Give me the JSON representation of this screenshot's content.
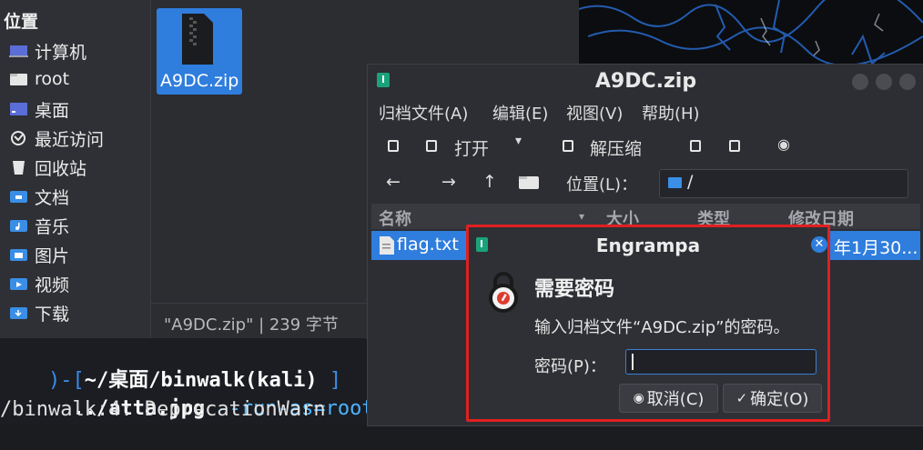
{
  "file_manager": {
    "sidebar": {
      "heading": "位置",
      "items": [
        {
          "label": "计算机",
          "icon": "computer-icon"
        },
        {
          "label": "root",
          "icon": "home-folder-icon"
        },
        {
          "label": "桌面",
          "icon": "desktop-icon"
        },
        {
          "label": "最近访问",
          "icon": "recent-icon"
        },
        {
          "label": "回收站",
          "icon": "trash-icon"
        },
        {
          "label": "文档",
          "icon": "documents-folder-icon"
        },
        {
          "label": "音乐",
          "icon": "music-folder-icon"
        },
        {
          "label": "图片",
          "icon": "pictures-folder-icon"
        },
        {
          "label": "视频",
          "icon": "videos-folder-icon"
        },
        {
          "label": "下载",
          "icon": "downloads-folder-icon"
        }
      ]
    },
    "file": {
      "name": "A9DC.zip",
      "icon": "zip-archive-icon"
    },
    "status": "\"A9DC.zip\" | 239 字节"
  },
  "terminal": {
    "prompt_open": ")-[",
    "prompt_path": "~/桌面/binwalk(kali)",
    "prompt_close": "]",
    "cmd_arg": "../atta.jpg",
    "cmd_flag": "--run-as=root",
    "output": "/binwalk:4: DeprecationWarn"
  },
  "archive": {
    "title": "A9DC.zip",
    "menu": [
      "归档文件(A)",
      "编辑(E)",
      "视图(V)",
      "帮助(H)"
    ],
    "toolbar": {
      "open_label": "打开",
      "extract_label": "解压缩"
    },
    "location": {
      "label": "位置(L)：",
      "path": "/"
    },
    "columns": [
      "名称",
      "大小",
      "类型",
      "修改日期"
    ],
    "rows": [
      {
        "name": "flag.txt",
        "modified": "年1月30..."
      }
    ]
  },
  "dialog": {
    "title": "Engrampa",
    "heading": "需要密码",
    "message": "输入归档文件“A9DC.zip”的密码。",
    "password_label": "密码(P)：",
    "password_value": "",
    "cancel_label": "取消(C)",
    "ok_label": "确定(O)"
  },
  "colors": {
    "accent": "#2f7ddd",
    "highlight_border": "#e02020",
    "terminal_path": "#4aa3ff"
  }
}
